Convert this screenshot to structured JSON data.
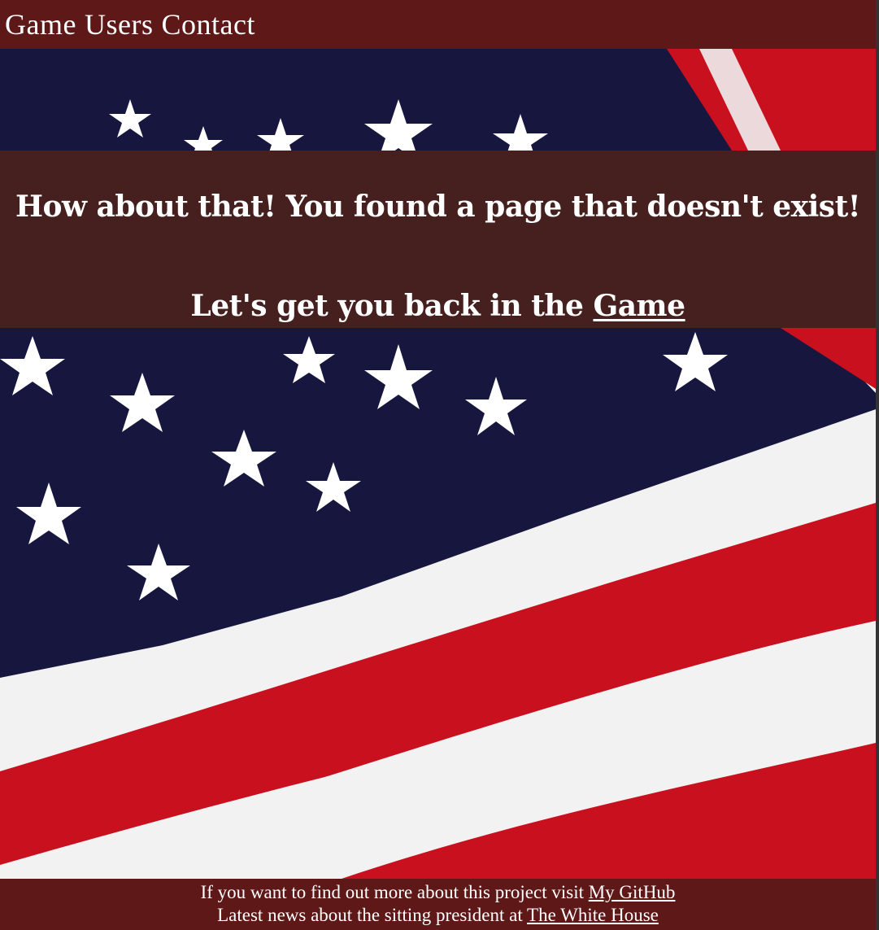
{
  "nav": {
    "items": [
      {
        "label": "Game"
      },
      {
        "label": "Users"
      },
      {
        "label": "Contact"
      }
    ]
  },
  "message": {
    "headline": "How about that! You found a page that doesn't exist!",
    "back_prefix": "Let's get you back in the ",
    "back_link": "Game"
  },
  "footer": {
    "line1_prefix": "If you want to find out more about this project visit ",
    "line1_link": "My GitHub",
    "line2_prefix": "Latest news about the sitting president at ",
    "line2_link": "The White House"
  },
  "colors": {
    "navbar": "#5e1818",
    "message_band": "#45201e",
    "flag_blue": "#16163f",
    "flag_red": "#c8101e",
    "flag_white": "#f2f2f2"
  }
}
